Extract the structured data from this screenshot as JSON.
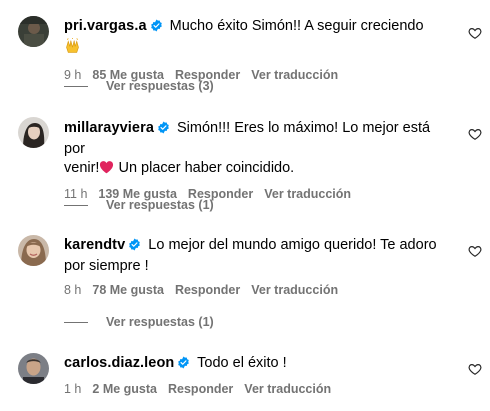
{
  "comments": [
    {
      "username": "pri.vargas.a",
      "text": "Mucho éxito Simón!! A seguir creciendo",
      "emoji": "raising-hands",
      "time": "9 h",
      "likes": "85 Me gusta",
      "reply": "Responder",
      "translate": "Ver traducción",
      "view_replies": "Ver respuestas (3)"
    },
    {
      "username": "millarayviera",
      "text_part1": "Simón!!! Eres lo máximo! Lo mejor está por",
      "text_part2a": "venir!",
      "text_part2b": " Un placer haber coincidido.",
      "emoji": "red-heart",
      "time": "11 h",
      "likes": "139 Me gusta",
      "reply": "Responder",
      "translate": "Ver traducción",
      "view_replies": "Ver respuestas (1)"
    },
    {
      "username": "karendtv",
      "text_part1": "Lo mejor del mundo amigo querido! Te adoro",
      "text_part2": "por siempre !",
      "time": "8 h",
      "likes": "78 Me gusta",
      "reply": "Responder",
      "translate": "Ver traducción",
      "view_replies": "Ver respuestas (1)"
    },
    {
      "username": "carlos.diaz.leon",
      "text": "Todo el éxito !",
      "time": "1 h",
      "likes": "2 Me gusta",
      "reply": "Responder",
      "translate": "Ver traducción"
    }
  ],
  "colors": {
    "verified_blue": "#0095f6",
    "meta_gray": "#737373",
    "heart_red": "#e0245e"
  },
  "icons": {
    "verified": "verified-badge-icon",
    "like": "heart-outline-icon"
  }
}
